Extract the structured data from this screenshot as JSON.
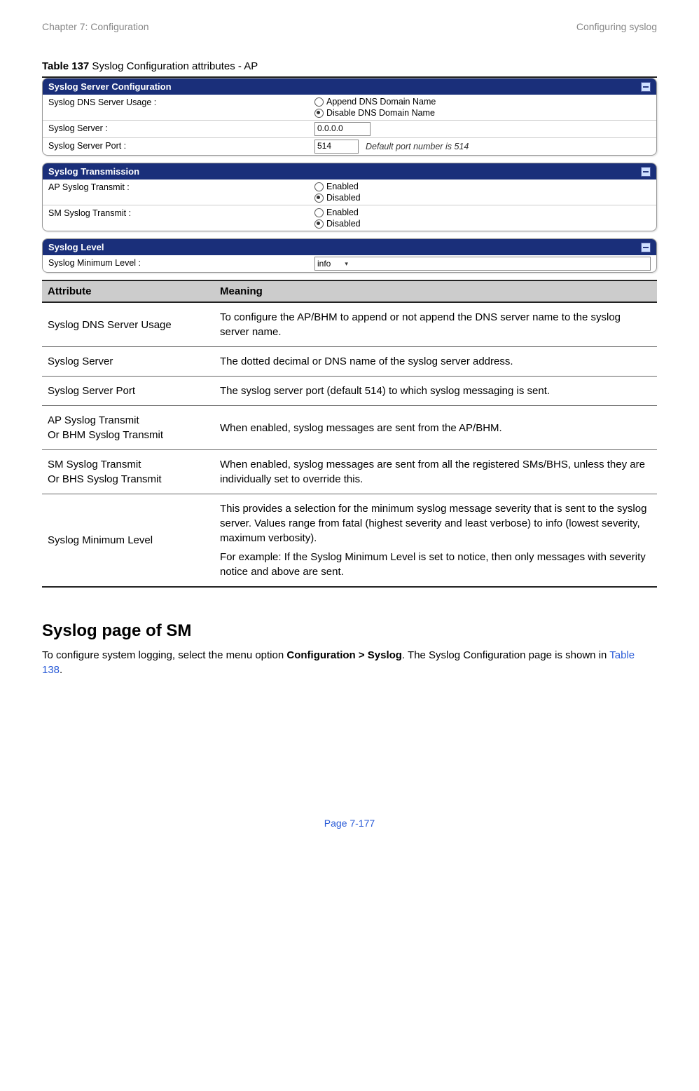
{
  "header": {
    "left": "Chapter 7:  Configuration",
    "right": "Configuring syslog"
  },
  "table_caption": {
    "bold": "Table 137",
    "rest": " Syslog Configuration attributes - AP"
  },
  "panel1": {
    "title": "Syslog Server Configuration",
    "row1_label": "Syslog DNS Server Usage :",
    "row1_opt1": "Append DNS Domain Name",
    "row1_opt2": "Disable DNS Domain Name",
    "row2_label": "Syslog Server :",
    "row2_value": "0.0.0.0",
    "row3_label": "Syslog Server Port :",
    "row3_value": "514",
    "row3_note": "Default port number is 514"
  },
  "panel2": {
    "title": "Syslog Transmission",
    "row1_label": "AP Syslog Transmit :",
    "row2_label": "SM Syslog Transmit :",
    "opt_enabled": "Enabled",
    "opt_disabled": "Disabled"
  },
  "panel3": {
    "title": "Syslog Level",
    "row1_label": "Syslog Minimum Level :",
    "row1_value": "info"
  },
  "attr_table": {
    "head_attr": "Attribute",
    "head_meaning": "Meaning",
    "rows": [
      {
        "attr1": "Syslog DNS Server Usage",
        "attr2": "",
        "meaning1": "To configure the AP/BHM to append or not append the DNS server name to the syslog server name.",
        "meaning2": ""
      },
      {
        "attr1": "Syslog Server",
        "attr2": "",
        "meaning1": "The dotted decimal or DNS name of the syslog server address.",
        "meaning2": ""
      },
      {
        "attr1": "Syslog Server Port",
        "attr2": "",
        "meaning1": "The syslog server port (default 514) to which syslog messaging is sent.",
        "meaning2": ""
      },
      {
        "attr1": "AP Syslog Transmit",
        "attr2": "Or BHM Syslog Transmit",
        "meaning1": "When enabled, syslog messages are sent from the AP/BHM.",
        "meaning2": ""
      },
      {
        "attr1": "SM Syslog Transmit",
        "attr2": "Or BHS Syslog Transmit",
        "meaning1": "When enabled, syslog messages are sent from all the registered SMs/BHS, unless they are individually set to override this.",
        "meaning2": ""
      },
      {
        "attr1": "Syslog Minimum Level",
        "attr2": "",
        "meaning1": "This provides a selection for the minimum syslog message severity that is sent to the syslog server. Values range from fatal (highest severity and least verbose) to info (lowest severity, maximum verbosity).",
        "meaning2": "For example: If the Syslog Minimum Level is set to notice, then only messages with severity notice and above are sent."
      }
    ]
  },
  "section": {
    "heading": "Syslog page of SM",
    "text_pre": "To configure system logging, select the menu option ",
    "text_bold": "Configuration > Syslog",
    "text_mid": ". The Syslog Configuration page is shown in ",
    "text_link": "Table 138",
    "text_end": "."
  },
  "footer": "Page 7-177"
}
